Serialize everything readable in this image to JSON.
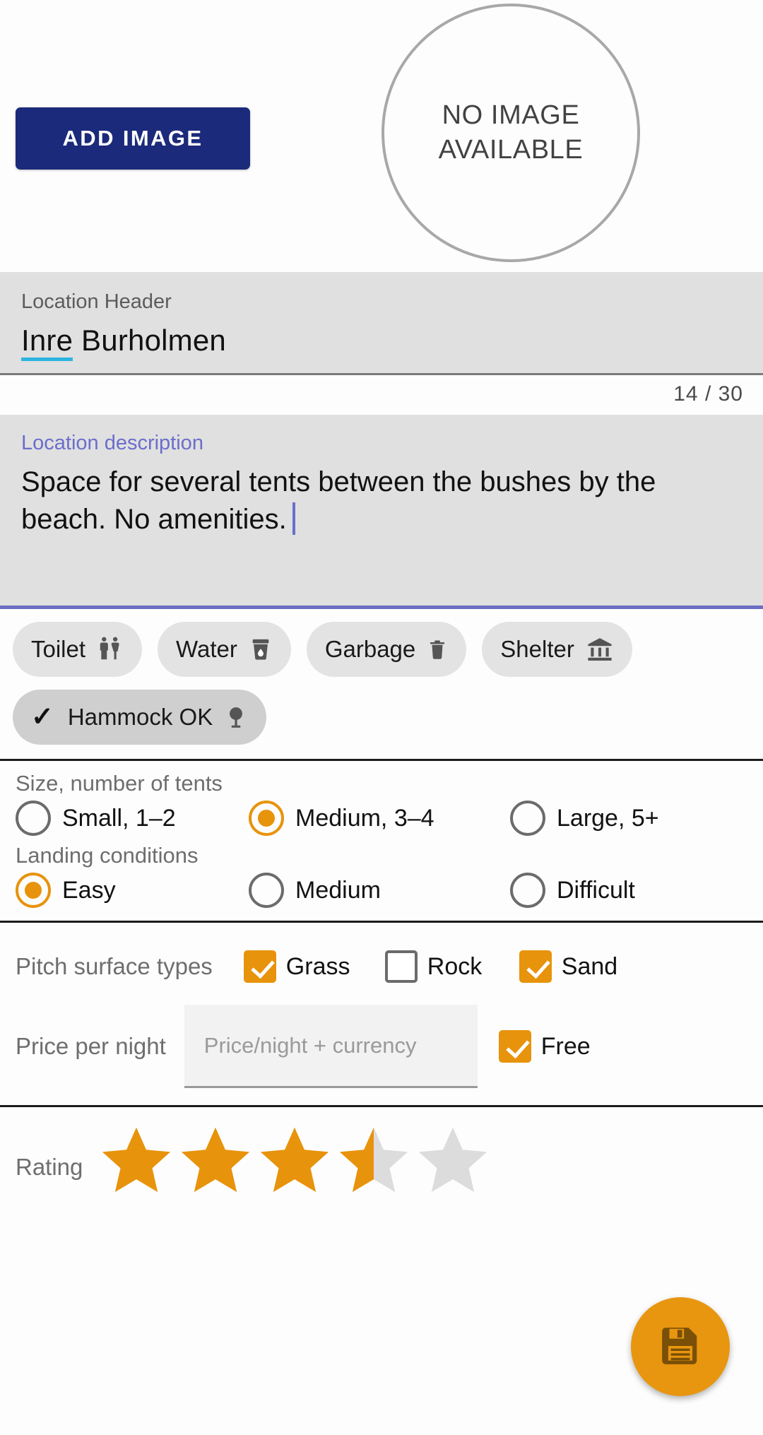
{
  "image_area": {
    "add_image_label": "ADD IMAGE",
    "no_image_line1": "NO IMAGE",
    "no_image_line2": "AVAILABLE"
  },
  "location_header": {
    "label": "Location Header",
    "value_spelled": "Inre",
    "value_rest": " Burholmen",
    "char_counter": "14 / 30"
  },
  "description": {
    "label": "Location description",
    "text": "Space for several tents between the bushes by the beach. No amenities."
  },
  "amenity_chips": [
    {
      "label": "Toilet",
      "icon": "wc-icon",
      "selected": false
    },
    {
      "label": "Water",
      "icon": "water-cup-icon",
      "selected": false
    },
    {
      "label": "Garbage",
      "icon": "trash-icon",
      "selected": false
    },
    {
      "label": "Shelter",
      "icon": "shelter-icon",
      "selected": false
    },
    {
      "label": "Hammock OK",
      "icon": "tree-icon",
      "selected": true
    }
  ],
  "size_group": {
    "label": "Size, number of tents",
    "options": [
      {
        "label": "Small, 1–2",
        "selected": false
      },
      {
        "label": "Medium, 3–4",
        "selected": true
      },
      {
        "label": "Large, 5+",
        "selected": false
      }
    ]
  },
  "landing_group": {
    "label": "Landing conditions",
    "options": [
      {
        "label": "Easy",
        "selected": true
      },
      {
        "label": "Medium",
        "selected": false
      },
      {
        "label": "Difficult",
        "selected": false
      }
    ]
  },
  "surface_group": {
    "label": "Pitch surface types",
    "options": [
      {
        "label": "Grass",
        "checked": true
      },
      {
        "label": "Rock",
        "checked": false
      },
      {
        "label": "Sand",
        "checked": true
      }
    ]
  },
  "price": {
    "label": "Price per night",
    "input_value": "",
    "input_placeholder": "Price/night + currency",
    "free_label": "Free",
    "free_checked": true
  },
  "rating": {
    "label": "Rating",
    "value": 3.5,
    "max": 5
  },
  "save_button": {
    "icon": "save-floppy-icon"
  },
  "colors": {
    "accent_orange": "#e8930c",
    "primary_navy": "#1b2a7a",
    "focus_purple": "#6b6ecb",
    "spell_underline": "#2ab5e0",
    "star_empty": "#dcdcdc"
  }
}
